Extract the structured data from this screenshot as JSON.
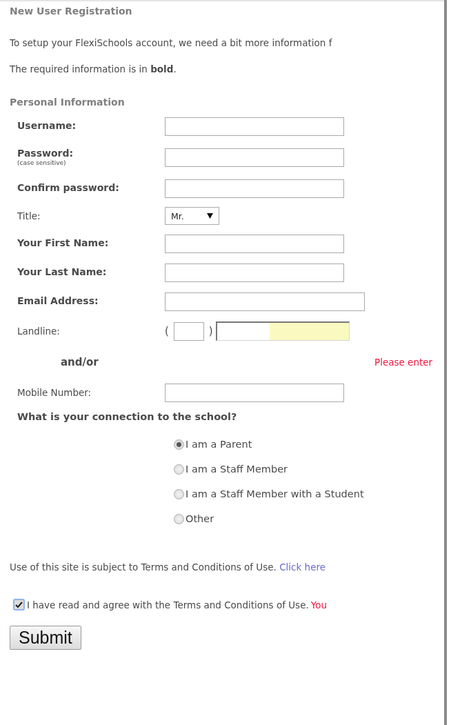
{
  "heading": "New User Registration",
  "intro": [
    "To setup your FlexiSchools account, we need a bit more information f",
    "The required information is in **bold**."
  ],
  "section": "Personal Information",
  "fields": [
    {
      "kind": "text",
      "label": "Username:",
      "required": true
    },
    {
      "kind": "text",
      "label": "Password:",
      "note": "(case sensitive)",
      "required": true
    },
    {
      "kind": "text",
      "label": "Confirm password:",
      "required": true
    },
    {
      "kind": "select",
      "label": "Title:",
      "required": false,
      "value": "Mr."
    },
    {
      "kind": "text",
      "label": "Your First Name:",
      "required": true
    },
    {
      "kind": "text",
      "label": "Your Last Name:",
      "required": true
    },
    {
      "kind": "email",
      "label": "Email Address:",
      "required": true
    },
    {
      "kind": "phone",
      "label": "Landline:",
      "required": false,
      "open": "(",
      "close": ")"
    },
    {
      "kind": "separator",
      "label": "and/or",
      "error": "Please enter"
    },
    {
      "kind": "text",
      "label": "Mobile Number:",
      "required": false
    }
  ],
  "question": "What is your connection to the school?",
  "options": [
    {
      "label": "I am a Parent",
      "selected": true
    },
    {
      "label": "I am a Staff Member",
      "selected": false
    },
    {
      "label": "I am a Staff Member with a Student",
      "selected": false
    },
    {
      "label": "Other",
      "selected": false
    }
  ],
  "terms": {
    "text": "Use of this site is subject to Terms and Conditions of Use.",
    "link": "Click here"
  },
  "agree": {
    "checked": true,
    "text": "I have read and agree with the Terms and Conditions of Use.",
    "error": "You"
  },
  "submit": "Submit"
}
